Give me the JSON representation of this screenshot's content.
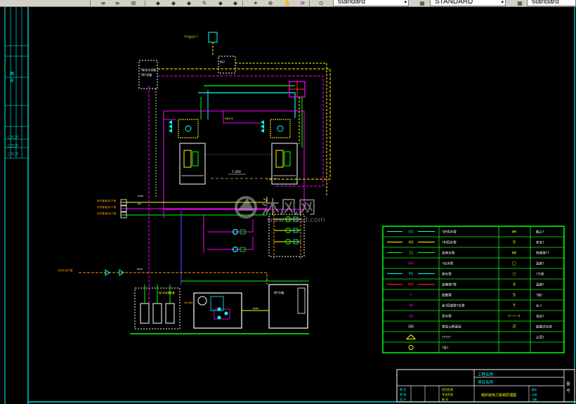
{
  "toolbar": {
    "style_combos": [
      "standard",
      "STANDARD",
      "standard"
    ],
    "icons": [
      "text-style-icon",
      "text-style-edit-icon",
      "dim-style-icon",
      "layer-icon",
      "layer-prev-icon",
      "layer-state-icon",
      "match-prop-icon",
      "linetype-icon",
      "lineweight-icon",
      "plot-icon",
      "zoom-icon",
      "pan-icon",
      "regen-icon",
      "properties-icon",
      "table-style-icon",
      "multileader-icon"
    ]
  },
  "watermark": {
    "name": "沐风网",
    "url": "www.mfcad.com"
  },
  "drawing": {
    "elevation": "7.300",
    "left_labels": [
      "燃气管道进口?管",
      "供热管道进口?管",
      "供热管道回水?管"
    ],
    "water_inlet": "自来水进口管",
    "tank_labels": [
      "?软化水设备",
      "P软?机组",
      "软?水处理设备"
    ],
    "box_labels": [
      "?烟道出口?",
      "PS?",
      "热?水箱"
    ]
  },
  "legend": {
    "rows": [
      {
        "code": "GS",
        "desc": "?炉供水管",
        "sym": "⋈",
        "sym_desc": "截止?"
      },
      {
        "code": "HS",
        "desc": "?炉回水管",
        "sym": "⚲",
        "sym_desc": "安全?"
      },
      {
        "code": "ZS",
        "desc": "自来水管",
        "sym": "⋈",
        "sym_desc": "快速排??"
      },
      {
        "code": "RH",
        "desc": "?化水管",
        "sym": "□",
        "sym_desc": "温度?"
      },
      {
        "code": "PS",
        "desc": "排水管",
        "sym": "○",
        "sym_desc": "?力表"
      },
      {
        "code": "PW",
        "desc": "定期排?管",
        "sym": "‡",
        "sym_desc": "温度?"
      },
      {
        "code": "F",
        "desc": "放散管",
        "sym": "S",
        "sym_desc": "?接?"
      },
      {
        "code": "YR",
        "desc": "余?回收管?水管",
        "sym": "Y",
        "sym_desc": "⊞ ⊬"
      },
      {
        "code": "XS",
        "desc": "泄水管",
        "sym": "⊢—⊣",
        "sym_desc": "混合?"
      },
      {
        "code": "DN",
        "desc": "管径公称直径",
        "sym": "∅",
        "sym_desc": "旋塞式水表"
      },
      {
        "code": "",
        "desc": "?????",
        "sym": "",
        "sym_desc": "止回?"
      },
      {
        "code": "",
        "desc": "?泵?",
        "sym": "",
        "sym_desc": ""
      }
    ]
  },
  "title_block": {
    "project_label": "工程名称",
    "item_label": "项目名称",
    "drawing_title": "锅炉房热力系统原理图",
    "left_cells": [
      "审 定",
      "审 核",
      "设 计"
    ],
    "mid_cells": [
      "项目负责",
      "专业负责",
      "校 对"
    ],
    "right_labels": [
      "图号",
      "比例",
      "日期"
    ]
  },
  "frame_left_marks": [
    "图",
    "号",
    "签",
    "字",
    "日期"
  ]
}
